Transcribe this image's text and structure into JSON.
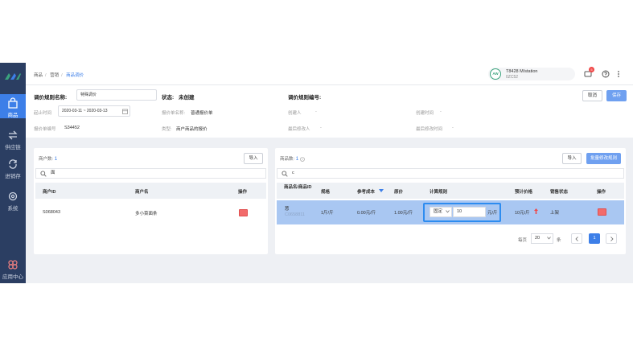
{
  "sidebar": {
    "items": [
      {
        "label": "商品",
        "icon": "bag-icon"
      },
      {
        "label": "供应链",
        "icon": "arrows-icon"
      },
      {
        "label": "进销存",
        "icon": "cycle-icon"
      },
      {
        "label": "系统",
        "icon": "gear-icon"
      },
      {
        "label": "应用中心",
        "icon": "apps-icon"
      }
    ]
  },
  "header": {
    "breadcrumb": [
      "商品",
      "营销",
      "商品调价"
    ],
    "store_avatar": "AW",
    "store_name": "T8428 M/station",
    "store_code": "0ZC52",
    "badge": "5"
  },
  "form": {
    "rule_name_label": "调价规则名称:",
    "rule_name_value": "特殊调价",
    "status_label": "状态:",
    "status_value": "未创建",
    "rule_no_label": "调价规则编号:",
    "rule_no_value": "",
    "time_label": "起止时间",
    "time_value": "2020-03-11 ~ 2020-03-13",
    "price_list_label": "报价单名称:",
    "price_list_value": "普通报价单",
    "creator_label": "创建人",
    "creator_value": "-",
    "create_time_label": "创建时间",
    "create_time_value": "-",
    "station_label": "报价单编号",
    "station_value": "S34452",
    "type_label": "类型:",
    "type_value": "商户商品的报价",
    "modifier_label": "最后修改人",
    "modifier_value": "-",
    "modify_time_label": "最后修改时间",
    "modify_time_value": "-",
    "cancel_label": "取消",
    "save_label": "保存"
  },
  "merchants": {
    "count_label": "商户数:",
    "count": "1",
    "import_label": "导入",
    "search_value": "面",
    "columns": [
      "商户ID",
      "商户名",
      "操作"
    ],
    "rows": [
      {
        "id": "S068043",
        "name": "多小菜面条"
      }
    ]
  },
  "products": {
    "count_label": "商品数:",
    "count": "1",
    "import_label": "导入",
    "batch_label": "批量修改规则",
    "search_value": "c",
    "columns": [
      "商品名/商品ID",
      "规格",
      "参考成本",
      "原价",
      "计算规则",
      "预计价格",
      "销售状态",
      "操作"
    ],
    "rows": [
      {
        "name": "葱",
        "id": "C0658811",
        "spec": "1斤/斤",
        "cost": "0.00元/斤",
        "price": "1.00元/斤",
        "rule_op": "固定",
        "rule_value": "10",
        "rule_unit": "元/斤",
        "new_price": "10元/斤",
        "status": "上架"
      }
    ],
    "per_page_label": "每页",
    "per_page_value": "20",
    "per_page_unit": "条",
    "current_page": "1"
  },
  "colors": {
    "sidebar": "#2b3e62",
    "accent": "#3d7fe8",
    "highlight": "#a9c7f2",
    "danger": "#f26b6b"
  }
}
